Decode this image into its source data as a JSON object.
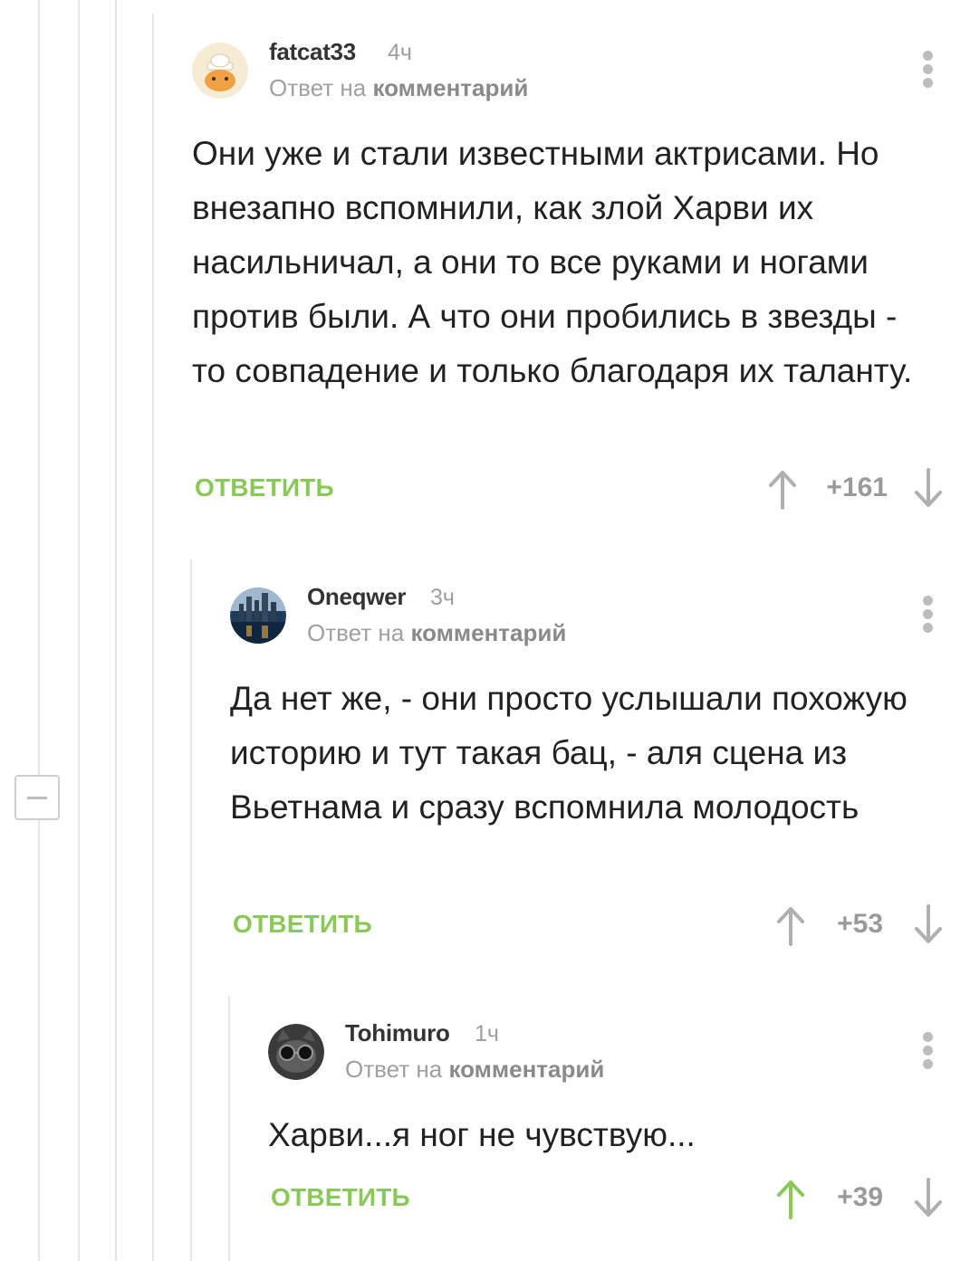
{
  "colors": {
    "accent_green": "#8ac858",
    "muted": "#9e9e9e",
    "thread_line": "#e6e6e6"
  },
  "comments": [
    {
      "author": "fatcat33",
      "time": "4ч",
      "reply_prefix": "Ответ на",
      "reply_target": "комментарий",
      "text": "Они уже и стали известными актрисами. Но внезапно вспомнили, как злой Харви их насильничал, а они то все руками и ногами против были. А что они пробились в звезды - то совпадение и только благодаря их таланту.",
      "reply_label": "ОТВЕТИТЬ",
      "score": "+161",
      "upvoted": false
    },
    {
      "author": "Oneqwer",
      "time": "3ч",
      "reply_prefix": "Ответ на",
      "reply_target": "комментарий",
      "text": "Да нет же,  - они просто услышали похожую историю и тут такая бац, - аля сцена из Вьетнама и сразу вспомнила молодость",
      "reply_label": "ОТВЕТИТЬ",
      "score": "+53",
      "upvoted": false
    },
    {
      "author": "Tohimuro",
      "time": "1ч",
      "reply_prefix": "Ответ на",
      "reply_target": "комментарий",
      "text": "Харви...я ног не чувствую...",
      "reply_label": "ОТВЕТИТЬ",
      "score": "+39",
      "upvoted": true
    }
  ],
  "icons": {
    "upvote": "arrow-up-icon",
    "downvote": "arrow-down-icon",
    "more": "more-vertical-icon",
    "collapse": "collapse-minus-icon"
  }
}
